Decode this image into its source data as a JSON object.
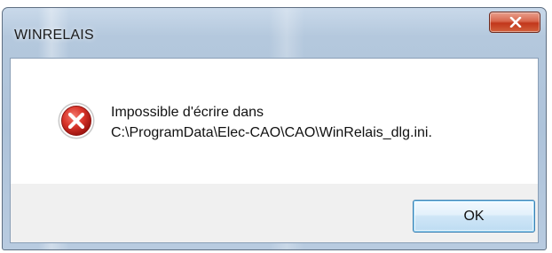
{
  "window": {
    "title": "WINRELAIS",
    "close_icon": "close-icon"
  },
  "message": {
    "icon": "error-icon",
    "line1": "Impossible d'écrire dans",
    "line2": "C:\\ProgramData\\Elec-CAO\\CAO\\WinRelais_dlg.ini."
  },
  "buttons": {
    "ok_label": "OK"
  },
  "colors": {
    "close_button": "#c2371b",
    "error_icon": "#c81c1c",
    "ok_button_border": "#3c7fb1"
  }
}
